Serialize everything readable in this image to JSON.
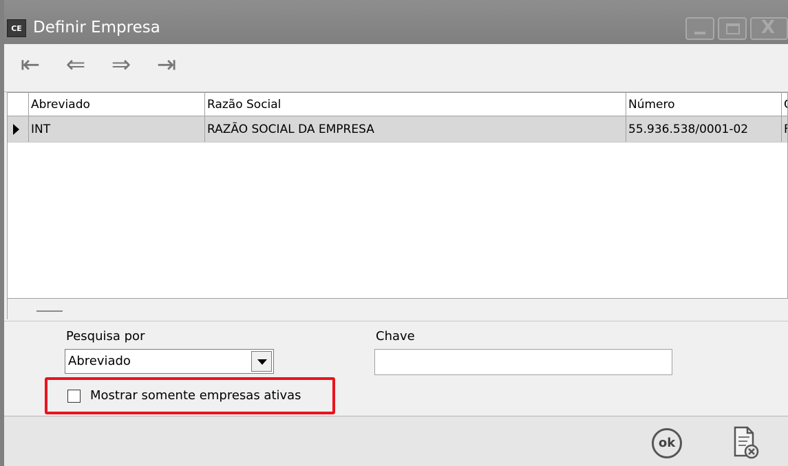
{
  "window": {
    "app_icon_text": "CE",
    "title": "Definir Empresa",
    "controls": {
      "close_glyph": "X"
    }
  },
  "navigation": {
    "first": "⇤",
    "previous": "⇐",
    "next": "⇒",
    "last": "⇥"
  },
  "grid": {
    "columns": [
      "Abreviado",
      "Razão Social",
      "Número",
      "C"
    ],
    "rows": [
      {
        "abreviado": "INT",
        "razao_social": "RAZÃO SOCIAL DA EMPRESA",
        "numero": "55.936.538/0001-02",
        "extra": "F"
      }
    ]
  },
  "filters": {
    "search_by_label": "Pesquisa por",
    "search_by_value": "Abreviado",
    "key_label": "Chave",
    "key_value": "",
    "active_only_label": "Mostrar somente empresas ativas",
    "active_only_checked": false
  },
  "actions": {
    "ok_label": "ok"
  },
  "colors": {
    "highlight": "#e8141e",
    "titlebar": "#8a8a8a",
    "selected_row": "#d8d8d8"
  }
}
